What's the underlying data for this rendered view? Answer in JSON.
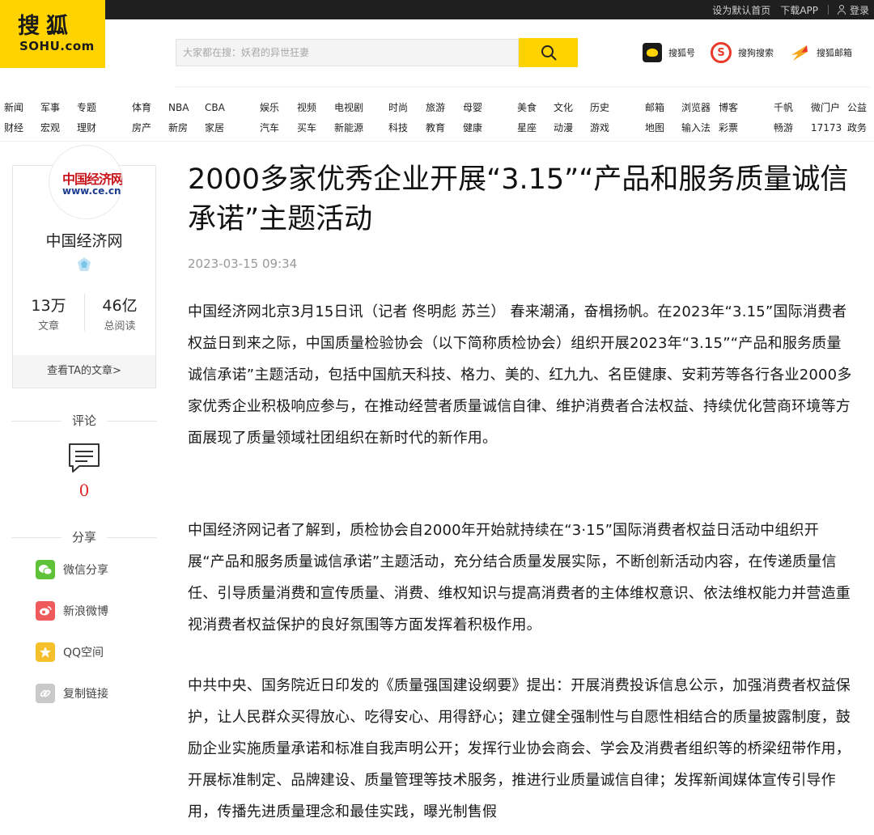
{
  "topbar": {
    "set_home": "设为默认首页",
    "download_app": "下载APP",
    "login": "登录"
  },
  "logo": {
    "cn": "搜狐",
    "en": "SOHU.com"
  },
  "search": {
    "placeholder": "大家都在搜：妖君的异世狂妻"
  },
  "apps": [
    {
      "label": "搜狐号",
      "icon": "sohuhao-icon"
    },
    {
      "label": "搜狗搜索",
      "icon": "sogou-icon"
    },
    {
      "label": "搜狐邮箱",
      "icon": "mail-icon"
    }
  ],
  "nav": [
    {
      "row1": [
        "新闻",
        "军事",
        "专题"
      ],
      "row2": [
        "财经",
        "宏观",
        "理财"
      ]
    },
    {
      "row1": [
        "体育",
        "NBA",
        "CBA"
      ],
      "row2": [
        "房产",
        "新房",
        "家居"
      ]
    },
    {
      "row1": [
        "娱乐",
        "视频",
        "电视剧"
      ],
      "row2": [
        "汽车",
        "买车",
        "新能源"
      ]
    },
    {
      "row1": [
        "时尚",
        "旅游",
        "母婴"
      ],
      "row2": [
        "科技",
        "教育",
        "健康"
      ]
    },
    {
      "row1": [
        "美食",
        "文化",
        "历史"
      ],
      "row2": [
        "星座",
        "动漫",
        "游戏"
      ]
    },
    {
      "row1": [
        "邮箱",
        "浏览器",
        "博客"
      ],
      "row2": [
        "地图",
        "输入法",
        "彩票"
      ]
    },
    {
      "row1": [
        "千帆",
        "微门户",
        "公益"
      ],
      "row2": [
        "畅游",
        "17173",
        "政务"
      ]
    }
  ],
  "author": {
    "logo_line1": "中国经济网",
    "logo_line2": "www.ce.cn",
    "name": "中国经济网",
    "articles_count": "13万",
    "articles_label": "文章",
    "reads_count": "46亿",
    "reads_label": "总阅读",
    "more_label": "查看TA的文章>"
  },
  "comments": {
    "title": "评论",
    "count": "0"
  },
  "share": {
    "title": "分享",
    "items": [
      {
        "label": "微信分享",
        "icon": "wechat-icon",
        "color": "#5fc33a"
      },
      {
        "label": "新浪微博",
        "icon": "weibo-icon",
        "color": "#ef5b5b"
      },
      {
        "label": "QQ空间",
        "icon": "qzone-icon",
        "color": "#f6c02c"
      },
      {
        "label": "复制链接",
        "icon": "link-icon",
        "color": "#c9c9c9"
      }
    ]
  },
  "article": {
    "title": "2000多家优秀企业开展“3.15”“产品和服务质量诚信承诺”主题活动",
    "date": "2023-03-15 09:34",
    "paragraphs": [
      "中国经济网北京3月15日讯（记者 佟明彪 苏兰） 春来潮涌，奋楫扬帆。在2023年“3.15”国际消费者权益日到来之际，中国质量检验协会（以下简称质检协会）组织开展2023年“3.15”“产品和服务质量诚信承诺”主题活动，包括中国航天科技、格力、美的、红九九、名臣健康、安莉芳等各行各业2000多家优秀企业积极响应参与，在推动经营者质量诚信自律、维护消费者合法权益、持续优化营商环境等方面展现了质量领域社团组织在新时代的新作用。",
      "中国经济网记者了解到，质检协会自2000年开始就持续在“3·15”国际消费者权益日活动中组织开展“产品和服务质量诚信承诺”主题活动，充分结合质量发展实际，不断创新活动内容，在传递质量信任、引导质量消费和宣传质量、消费、维权知识与提高消费者的主体维权意识、依法维权能力并营造重视消费者权益保护的良好氛围等方面发挥着积极作用。",
      "中共中央、国务院近日印发的《质量强国建设纲要》提出：开展消费投诉信息公示，加强消费者权益保护，让人民群众买得放心、吃得安心、用得舒心；建立健全强制性与自愿性相结合的质量披露制度，鼓励企业实施质量承诺和标准自我声明公开；发挥行业协会商会、学会及消费者组织等的桥梁纽带作用，开展标准制定、品牌建设、质量管理等技术服务，推进行业质量诚信自律；发挥新闻媒体宣传引导作用，传播先进质量理念和最佳实践，曝光制售假"
    ]
  },
  "colors": {
    "brand_yellow": "#ffd300",
    "topbar": "#1f1f1f",
    "comment_red": "#e0272c"
  }
}
